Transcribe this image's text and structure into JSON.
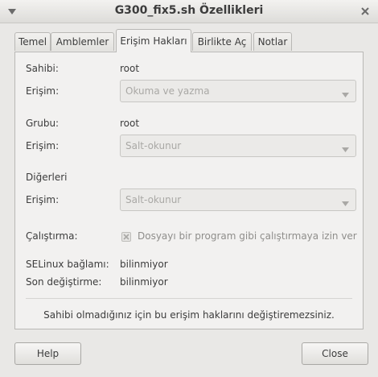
{
  "window": {
    "title": "G300_fix5.sh Özellikleri",
    "menu_icon": "chevron-down-icon",
    "close_icon": "close-icon"
  },
  "tabs": [
    {
      "label": "Temel",
      "active": false
    },
    {
      "label": "Amblemler",
      "active": false
    },
    {
      "label": "Erişim Hakları",
      "active": true
    },
    {
      "label": "Birlikte Aç",
      "active": false
    },
    {
      "label": "Notlar",
      "active": false
    }
  ],
  "owner": {
    "label": "Sahibi:",
    "value": "root",
    "access_label": "Erişim:",
    "access_value": "Okuma ve yazma"
  },
  "group": {
    "label": "Grubu:",
    "value": "root",
    "access_label": "Erişim:",
    "access_value": "Salt-okunur"
  },
  "others": {
    "label": "Diğerleri",
    "access_label": "Erişim:",
    "access_value": "Salt-okunur"
  },
  "execute": {
    "label": "Çalıştırma:",
    "checkbox_label": "Dosyayı bir program gibi çalıştırmaya izin ver",
    "checked": true,
    "enabled": false
  },
  "selinux": {
    "label": "SELinux bağlamı:",
    "value": "bilinmiyor"
  },
  "modified": {
    "label": "Son değiştirme:",
    "value": "bilinmiyor"
  },
  "notice": "Sahibi olmadığınız için bu erişim haklarını değiştiremezsiniz.",
  "buttons": {
    "help": "Help",
    "close": "Close"
  },
  "colors": {
    "disabled_text": "#a9a8a5",
    "background": "#e9e8e6",
    "panel": "#f2f1f0"
  }
}
